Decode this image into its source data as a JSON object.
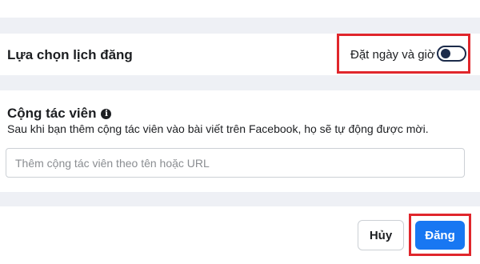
{
  "schedule": {
    "title": "Lựa chọn lịch đăng",
    "option_label": "Đặt ngày và giờ",
    "toggle_on": false
  },
  "collaborators": {
    "title": "Cộng tác viên",
    "info_icon": "info-icon",
    "description": "Sau khi bạn thêm cộng tác viên vào bài viết trên Facebook, họ sẽ tự động được mời.",
    "input_placeholder": "Thêm cộng tác viên theo tên hoặc URL",
    "input_value": ""
  },
  "footer": {
    "cancel_label": "Hủy",
    "submit_label": "Đăng"
  },
  "colors": {
    "accent": "#1877f2",
    "highlight": "#e0262c",
    "background": "#eef0f5"
  }
}
